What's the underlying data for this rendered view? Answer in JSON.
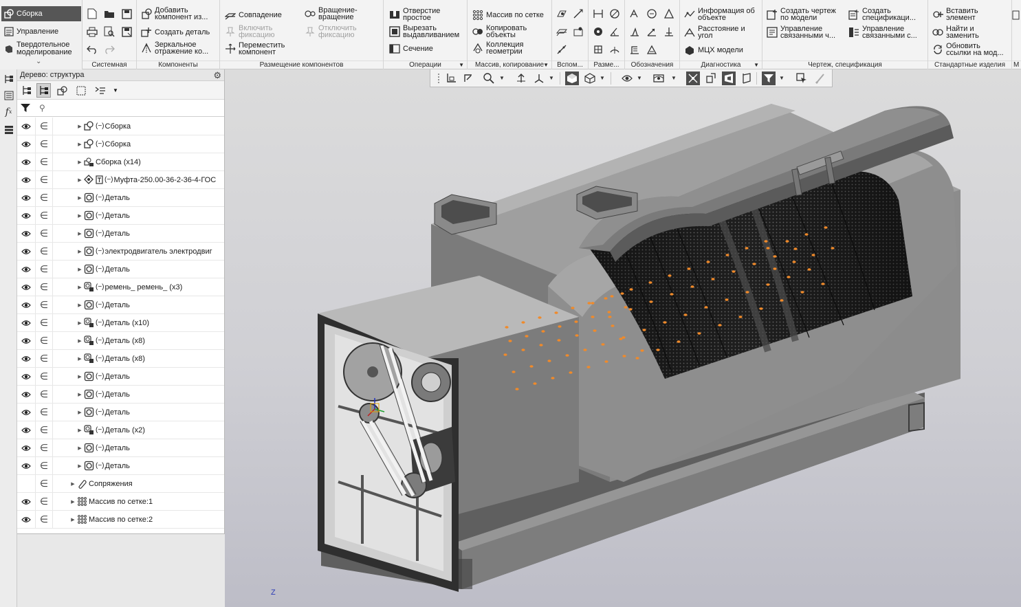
{
  "mode_panel": {
    "items": [
      {
        "label": "Сборка",
        "icon": "assembly-icon",
        "active": true
      },
      {
        "label": "Управление",
        "icon": "manage-icon",
        "active": false
      },
      {
        "label": "Твердотельное\nмоделирование",
        "icon": "solid-icon",
        "active": false
      }
    ]
  },
  "ribbon": {
    "groups": {
      "system": "Системная",
      "components": "Компоненты",
      "placement": "Размещение компонентов",
      "operations": "Операции",
      "array": "Массив, копирование",
      "aux": "Вспом...",
      "sizes": "Разме...",
      "designations": "Обозначения",
      "diagnostics": "Диагностика",
      "drawing": "Чертеж, спецификация",
      "standard": "Стандартные изделия",
      "more": "М"
    },
    "buttons": {
      "add_component": "Добавить\nкомпонент из...",
      "create_part": "Создать деталь",
      "mirror": "Зеркальное\nотражение ко...",
      "coincidence": "Совпадение",
      "rotation": "Вращение-\nвращение",
      "enable_fix": "Включить\nфиксацию",
      "disable_fix": "Отключить\nфиксацию",
      "move_component": "Переместить\nкомпонент",
      "hole": "Отверстие\nпростое",
      "cut_extrude": "Вырезать\nвыдавливанием",
      "section": "Сечение",
      "grid_array": "Массив по сетке",
      "copy_objects": "Копировать\nобъекты",
      "geometry_collection": "Коллекция\nгеометрии",
      "info": "Информация об\nобъекте",
      "distance": "Расстояние и\nугол",
      "mcx": "МЦХ модели",
      "create_drawing": "Создать чертеж\nпо модели",
      "manage_linked_1": "Управление\nсвязанными ч...",
      "create_spec": "Создать\nспецификаци...",
      "manage_linked_2": "Управление\nсвязанными с...",
      "insert_element": "Вставить\nэлемент",
      "find_replace": "Найти и\nзаменить",
      "update_links": "Обновить\nссылки на мод..."
    }
  },
  "tree": {
    "header": "Дерево: структура",
    "search_placeholder": "",
    "rows": [
      {
        "label": "Сборка",
        "icon": "assembly",
        "eye": true,
        "prefix": true,
        "indent": 1
      },
      {
        "label": "Сборка",
        "icon": "assembly",
        "eye": true,
        "prefix": true,
        "indent": 1
      },
      {
        "label": "Сборка (x14)",
        "icon": "assembly-multi",
        "eye": true,
        "prefix": false,
        "indent": 1
      },
      {
        "label": "Муфта-250.00-36-2-36-4-ГОС",
        "icon": "standard",
        "eye": true,
        "prefix": true,
        "indent": 1
      },
      {
        "label": "Деталь",
        "icon": "part",
        "eye": true,
        "prefix": true,
        "indent": 1
      },
      {
        "label": "Деталь",
        "icon": "part",
        "eye": true,
        "prefix": true,
        "indent": 1
      },
      {
        "label": "Деталь",
        "icon": "part",
        "eye": true,
        "prefix": true,
        "indent": 1
      },
      {
        "label": "электродвигатель электродвиг",
        "icon": "part",
        "eye": true,
        "prefix": true,
        "indent": 1
      },
      {
        "label": "Деталь",
        "icon": "part",
        "eye": true,
        "prefix": true,
        "indent": 1
      },
      {
        "label": "ремень_ ремень_ (x3)",
        "icon": "part-multi",
        "eye": true,
        "prefix": true,
        "indent": 1
      },
      {
        "label": "Деталь",
        "icon": "part",
        "eye": true,
        "prefix": true,
        "indent": 1
      },
      {
        "label": "Деталь (x10)",
        "icon": "part-multi",
        "eye": true,
        "prefix": true,
        "indent": 1
      },
      {
        "label": "Деталь (x8)",
        "icon": "part-multi",
        "eye": true,
        "prefix": true,
        "indent": 1
      },
      {
        "label": "Деталь (x8)",
        "icon": "part-multi",
        "eye": true,
        "prefix": true,
        "indent": 1
      },
      {
        "label": "Деталь",
        "icon": "part",
        "eye": true,
        "prefix": true,
        "indent": 1
      },
      {
        "label": "Деталь",
        "icon": "part",
        "eye": true,
        "prefix": true,
        "indent": 1
      },
      {
        "label": "Деталь",
        "icon": "part",
        "eye": true,
        "prefix": true,
        "indent": 1
      },
      {
        "label": "Деталь (x2)",
        "icon": "part-multi",
        "eye": true,
        "prefix": true,
        "indent": 1
      },
      {
        "label": "Деталь",
        "icon": "part",
        "eye": true,
        "prefix": true,
        "indent": 1
      },
      {
        "label": "Деталь",
        "icon": "part",
        "eye": true,
        "prefix": true,
        "indent": 1
      },
      {
        "label": "Сопряжения",
        "icon": "mates",
        "eye": false,
        "prefix": false,
        "indent": 0
      },
      {
        "label": "Массив по сетке:1",
        "icon": "grid",
        "eye": true,
        "prefix": false,
        "indent": 0
      },
      {
        "label": "Массив по сетке:2",
        "icon": "grid",
        "eye": true,
        "prefix": false,
        "indent": 0
      }
    ]
  },
  "viewport": {
    "axis_label": "Z",
    "colors": {
      "accent_orange": "#f08a2a",
      "body_gray": "#8a8a8a",
      "dark_gray": "#3c3c3c"
    }
  }
}
